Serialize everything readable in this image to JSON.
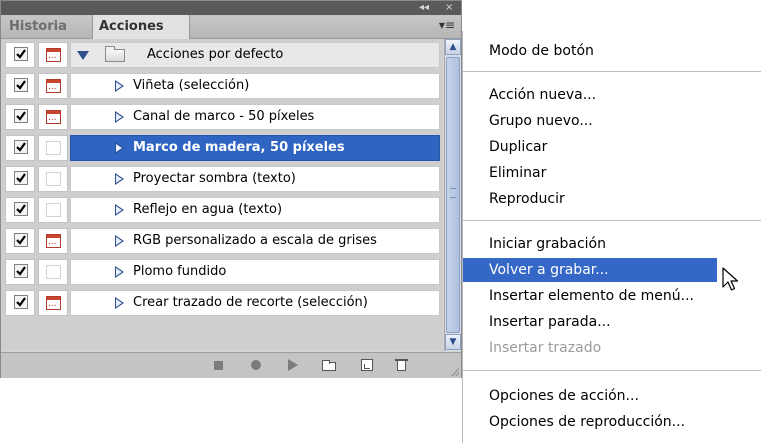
{
  "panel": {
    "tabs": [
      {
        "label": "Historia",
        "active": false
      },
      {
        "label": "Acciones",
        "active": true
      }
    ],
    "window_controls": {
      "collapse": "◂◂",
      "close": "×"
    },
    "rows": [
      {
        "label": "Acciones por defecto",
        "type": "set",
        "checked": true,
        "dialog": true,
        "expanded": true
      },
      {
        "label": "Viñeta (selección)",
        "type": "action",
        "checked": true,
        "dialog": true
      },
      {
        "label": "Canal de marco - 50 píxeles",
        "type": "action",
        "checked": true,
        "dialog": true
      },
      {
        "label": "Marco de madera, 50 píxeles",
        "type": "action",
        "checked": true,
        "dialog": false,
        "selected": true
      },
      {
        "label": "Proyectar sombra (texto)",
        "type": "action",
        "checked": true,
        "dialog": false
      },
      {
        "label": "Reflejo en agua (texto)",
        "type": "action",
        "checked": true,
        "dialog": false
      },
      {
        "label": "RGB personalizado a escala de grises",
        "type": "action",
        "checked": true,
        "dialog": true
      },
      {
        "label": "Plomo fundido",
        "type": "action",
        "checked": true,
        "dialog": false
      },
      {
        "label": "Crear trazado de recorte (selección)",
        "type": "action",
        "checked": true,
        "dialog": true
      }
    ],
    "bottom_icons": [
      "stop-icon",
      "record-icon",
      "play-icon",
      "new-set-icon",
      "new-action-icon",
      "trash-icon"
    ]
  },
  "menu": {
    "items": [
      {
        "label": "Modo de botón",
        "state": "normal"
      },
      {
        "label": "Acción nueva...",
        "state": "normal"
      },
      {
        "label": "Grupo nuevo...",
        "state": "normal"
      },
      {
        "label": "Duplicar",
        "state": "normal"
      },
      {
        "label": "Eliminar",
        "state": "normal"
      },
      {
        "label": "Reproducir",
        "state": "normal"
      },
      {
        "label": "Iniciar grabación",
        "state": "normal"
      },
      {
        "label": "Volver a grabar...",
        "state": "highlighted"
      },
      {
        "label": "Insertar elemento de menú...",
        "state": "normal"
      },
      {
        "label": "Insertar parada...",
        "state": "normal"
      },
      {
        "label": "Insertar trazado",
        "state": "disabled"
      },
      {
        "label": "Opciones de acción...",
        "state": "normal"
      },
      {
        "label": "Opciones de reproducción...",
        "state": "normal"
      }
    ]
  },
  "colors": {
    "selection": "#2f64c3",
    "menu_highlight": "#3567c6",
    "dialog_icon": "#c8462e"
  }
}
